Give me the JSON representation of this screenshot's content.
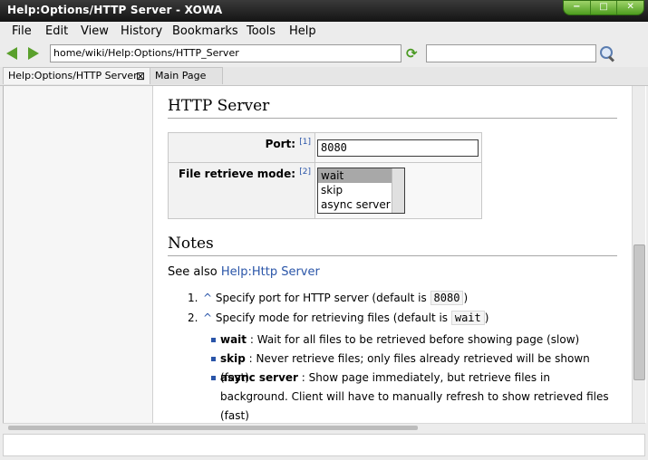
{
  "window": {
    "title": "Help:Options/HTTP Server - XOWA",
    "controls": [
      "−",
      "□",
      "✕"
    ]
  },
  "menu": [
    "File",
    "Edit",
    "View",
    "History",
    "Bookmarks",
    "Tools",
    "Help"
  ],
  "nav": {
    "url": "home/wiki/Help:Options/HTTP_Server",
    "search_value": ""
  },
  "tabs": [
    {
      "label": "Help:Options/HTTP Server",
      "close": "⊠"
    },
    {
      "label": "Main Page"
    }
  ],
  "page": {
    "heading": "HTTP Server",
    "options": {
      "port_label": "Port:",
      "port_ref": "[1]",
      "port_value": "8080",
      "mode_label": "File retrieve mode:",
      "mode_ref": "[2]",
      "mode_options": [
        "wait",
        "skip",
        "async server"
      ],
      "mode_selected": "wait"
    },
    "notes_heading": "Notes",
    "see_also_prefix": "See also ",
    "see_also_link": "Help:Http Server",
    "notes": [
      {
        "num": "1.",
        "caret": "^",
        "text": " Specify port for HTTP server (default is ",
        "code": "8080",
        "end": ")"
      },
      {
        "num": "2.",
        "caret": "^",
        "text": " Specify mode for retrieving files (default is ",
        "code": "wait",
        "end": ")"
      }
    ],
    "modes": [
      {
        "term": "wait",
        "desc": " : Wait for all files to be retrieved before showing page (slow)"
      },
      {
        "term": "skip",
        "desc": " : Never retrieve files; only files already retrieved will be shown (fast)"
      },
      {
        "term": "async server",
        "desc": " : Show page immediately, but retrieve files in background. Client will have to manually refresh to show retrieved files (fast)"
      }
    ]
  },
  "colors": {
    "link": "#2a55a8",
    "accent_green": "#5aa02c"
  }
}
